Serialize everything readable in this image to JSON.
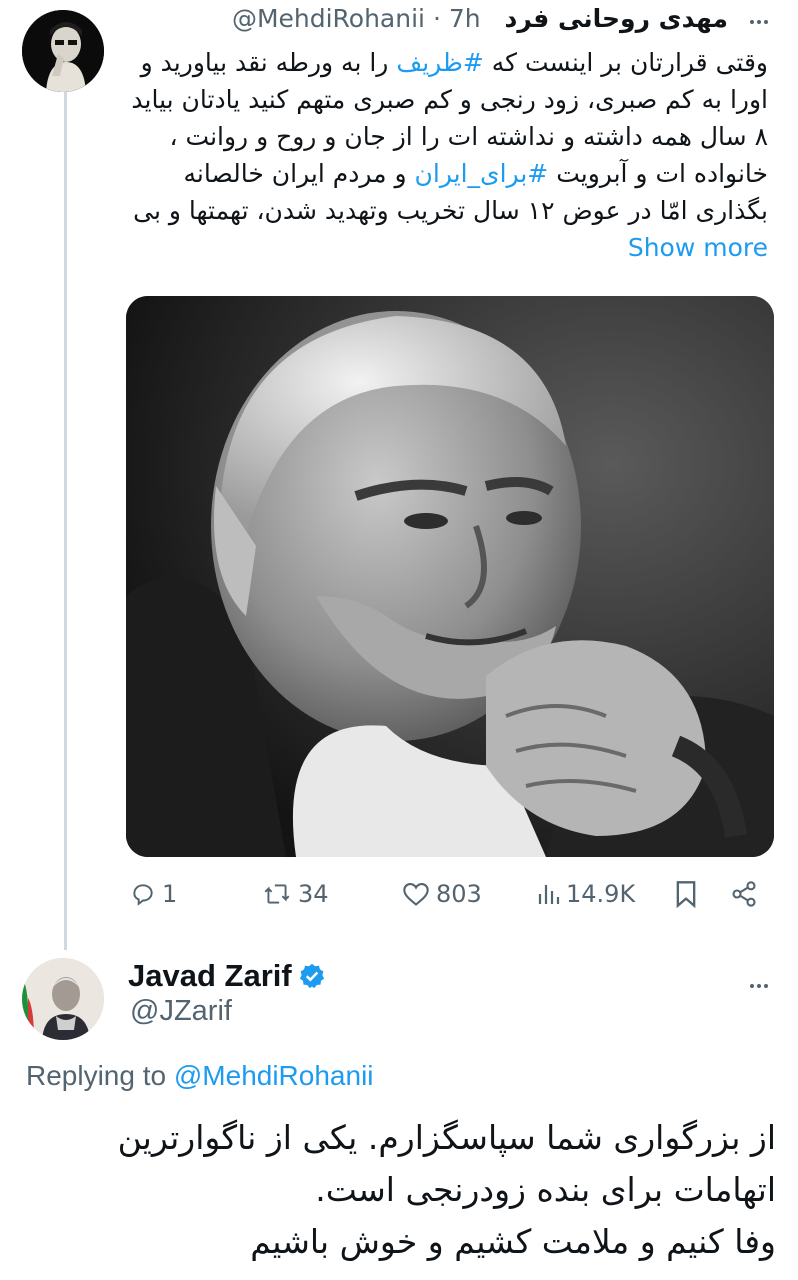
{
  "tweet": {
    "author_name": "مهدی روحانی فرد",
    "handle": "@MehdiRohanii",
    "separator": "·",
    "time": "7h",
    "text_segments": [
      {
        "text": "وقتی قرارتان بر اینست که ",
        "type": "plain"
      },
      {
        "text": "#ظریف",
        "type": "hashtag"
      },
      {
        "text": " را به ورطه نقد بیاورید و اورا به کم صبری، زود رنجی و کم صبری متهم کنید یادتان بیاید ۸ سال همه داشته و نداشته ات را از جان و روح و روانت ، خانواده ات و آبرویت ",
        "type": "plain"
      },
      {
        "text": "#برای_ایران",
        "type": "hashtag"
      },
      {
        "text": " و مردم ایران خالصانه بگذاری امّا در عوض ۱۲ سال تخریب وتهدید شدن، تهمتها و بی ",
        "type": "plain"
      }
    ],
    "show_more": "Show more",
    "stats": {
      "replies": "1",
      "retweets": "34",
      "likes": "803",
      "views": "14.9K"
    }
  },
  "reply": {
    "author_name": "Javad Zarif",
    "handle": "@JZarif",
    "replying_to_label": "Replying to",
    "replying_to_handle": "@MehdiRohanii",
    "lines": [
      "از بزرگواری شما سپاسگزارم.  یکی از ناگوارترین",
      "اتهامات برای بنده زودرنجی است.",
      "وفا کنیم و ملامت کشیم و خوش باشیم"
    ]
  },
  "icons": {
    "reply": "reply-icon",
    "retweet": "retweet-icon",
    "like": "heart-icon",
    "views": "views-icon",
    "bookmark": "bookmark-icon",
    "share": "share-icon",
    "verified": "verified-badge-icon",
    "more": "more-options-icon"
  },
  "colors": {
    "link": "#1d9bf0",
    "text": "#0f1419",
    "secondary": "#536471",
    "thread_line": "#cfd9de"
  }
}
